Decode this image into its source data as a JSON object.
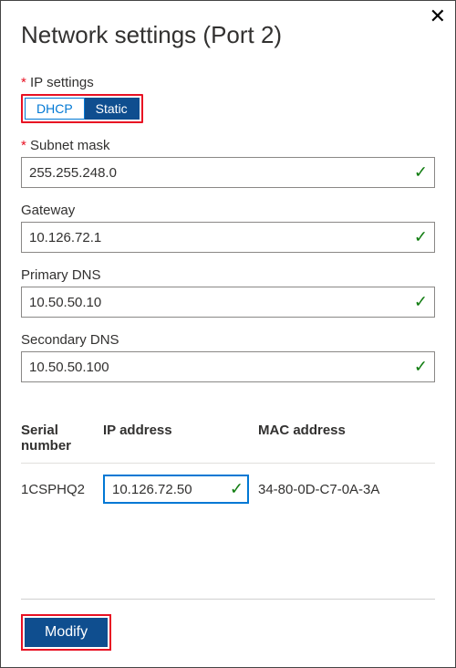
{
  "header": {
    "title": "Network settings (Port 2)"
  },
  "fields": {
    "ip_settings": {
      "label": "IP settings",
      "options": {
        "dhcp": "DHCP",
        "static": "Static"
      },
      "selected": "static"
    },
    "subnet_mask": {
      "label": "Subnet mask",
      "value": "255.255.248.0",
      "valid": true
    },
    "gateway": {
      "label": "Gateway",
      "value": "10.126.72.1",
      "valid": true
    },
    "primary_dns": {
      "label": "Primary DNS",
      "value": "10.50.50.10",
      "valid": true
    },
    "secondary_dns": {
      "label": "Secondary DNS",
      "value": "10.50.50.100",
      "valid": true
    }
  },
  "table": {
    "headers": {
      "serial": "Serial number",
      "ip": "IP address",
      "mac": "MAC address"
    },
    "rows": [
      {
        "serial": "1CSPHQ2",
        "ip": "10.126.72.50",
        "ip_valid": true,
        "mac": "34-80-0D-C7-0A-3A"
      }
    ]
  },
  "footer": {
    "modify_label": "Modify"
  },
  "colors": {
    "primary": "#0f4e8f",
    "accent": "#0078d4",
    "error": "#e81123",
    "success": "#107c10"
  }
}
